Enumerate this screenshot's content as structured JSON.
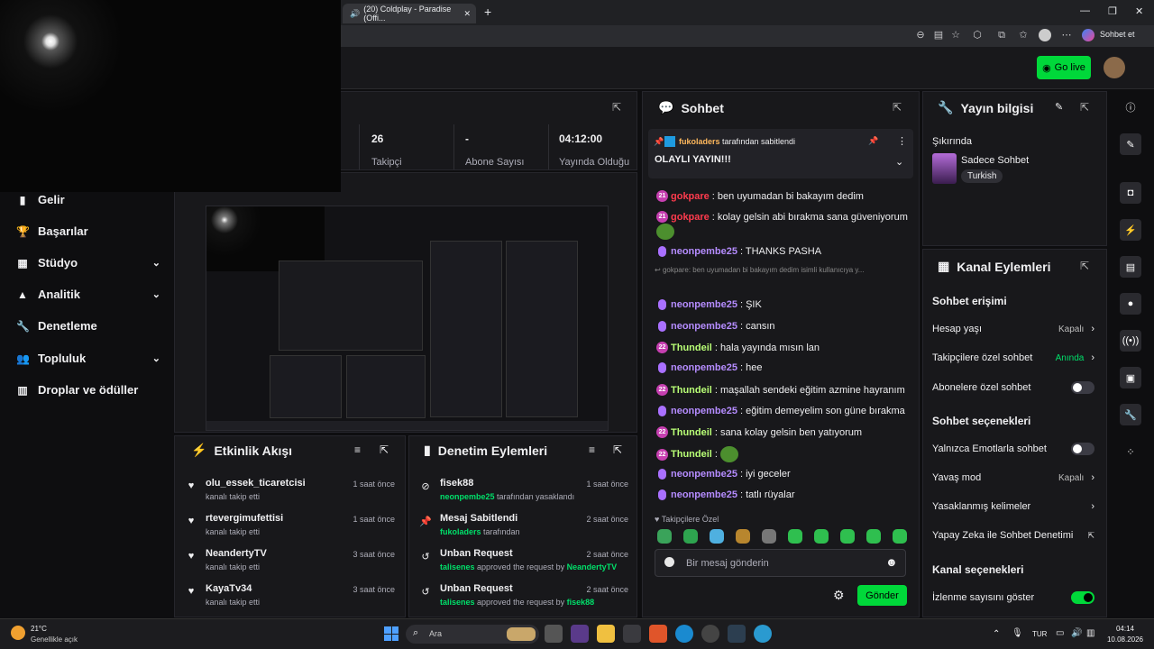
{
  "browser": {
    "tab_title": "(20) Coldplay - Paradise (Offi...",
    "sohbet_label": "Sohbet et"
  },
  "header": {
    "go_live": "Go live"
  },
  "nav": {
    "items": [
      {
        "label": "Gelir",
        "icon": "bars-icon",
        "expandable": false
      },
      {
        "label": "Başarılar",
        "icon": "trophy-icon",
        "expandable": false
      },
      {
        "label": "Stüdyo",
        "icon": "studio-icon",
        "expandable": true
      },
      {
        "label": "Analitik",
        "icon": "chart-icon",
        "expandable": true
      },
      {
        "label": "Denetleme",
        "icon": "wrench-icon",
        "expandable": false
      },
      {
        "label": "Topluluk",
        "icon": "community-icon",
        "expandable": true
      },
      {
        "label": "Droplar ve ödüller",
        "icon": "drops-icon",
        "expandable": false
      }
    ]
  },
  "stats": [
    {
      "value": "26",
      "label": "Takipçi"
    },
    {
      "value": "-",
      "label": "Abone Sayısı"
    },
    {
      "value": "04:12:00",
      "label": "Yayında Olduğu"
    }
  ],
  "activity": {
    "title": "Etkinlik Akışı",
    "items": [
      {
        "name": "olu_essek_ticaretcisi",
        "sub": "kanalı takip etti",
        "time": "1 saat önce"
      },
      {
        "name": "rtevergimufettisi",
        "sub": "kanalı takip etti",
        "time": "1 saat önce"
      },
      {
        "name": "NeandertyTV",
        "sub": "kanalı takip etti",
        "time": "3 saat önce"
      },
      {
        "name": "KayaTv34",
        "sub": "kanalı takip etti",
        "time": "3 saat önce"
      }
    ]
  },
  "moderation": {
    "title": "Denetim Eylemleri",
    "items": [
      {
        "title": "fisek88",
        "actor": "neonpembe25",
        "rest": "tarafından yasaklandı",
        "time": "1 saat önce",
        "icon": "ban-icon"
      },
      {
        "title": "Mesaj Sabitlendi",
        "actor": "fukoladers",
        "rest": "tarafından",
        "time": "2 saat önce",
        "icon": "pin-icon"
      },
      {
        "title": "Unban Request",
        "actor": "talisenes",
        "rest": "approved the request by",
        "target": "NeandertyTV",
        "time": "2 saat önce",
        "icon": "undo-icon"
      },
      {
        "title": "Unban Request",
        "actor": "talisenes",
        "rest": "approved the request by",
        "target": "fisek88",
        "time": "2 saat önce",
        "icon": "undo-icon"
      }
    ]
  },
  "chat": {
    "title": "Sohbet",
    "pinned_by": "fukoladers",
    "pinned_suffix": "tarafından sabitlendi",
    "pinned_text": "OLAYLI YAYIN!!!",
    "messages": [
      {
        "user": "gokpare",
        "text": ": ben uyumadan bi bakayım dedim",
        "badge": "21",
        "cls": "u1"
      },
      {
        "user": "gokpare",
        "text": ": kolay gelsin abi bırakma sana güveniyorum",
        "badge": "21",
        "cls": "u1"
      },
      {
        "user": "neonpembe25",
        "text": ": THANKS PASHA",
        "badge": "mic",
        "cls": "u2"
      },
      {
        "user": "neonpembe25",
        "text": ": ŞIK",
        "badge": "mic",
        "cls": "u2"
      },
      {
        "user": "neonpembe25",
        "text": ": cansın",
        "badge": "mic",
        "cls": "u2"
      },
      {
        "user": "Thundeil",
        "text": ": hala yayında mısın lan",
        "badge": "22",
        "cls": "u3"
      },
      {
        "user": "neonpembe25",
        "text": ": hee",
        "badge": "mic",
        "cls": "u2"
      },
      {
        "user": "Thundeil",
        "text": ": maşallah sendeki eğitim azmine hayranım",
        "badge": "22",
        "cls": "u3"
      },
      {
        "user": "neonpembe25",
        "text": ": eğitim demeyelim son güne bırakma",
        "badge": "mic",
        "cls": "u2"
      },
      {
        "user": "Thundeil",
        "text": ": sana kolay gelsin ben yatıyorum",
        "badge": "22",
        "cls": "u3"
      },
      {
        "user": "Thundeil",
        "text": ":",
        "badge": "22",
        "cls": "u3"
      },
      {
        "user": "neonpembe25",
        "text": ": iyi geceler",
        "badge": "mic",
        "cls": "u2"
      },
      {
        "user": "neonpembe25",
        "text": ": tatlı rüyalar",
        "badge": "mic",
        "cls": "u2"
      }
    ],
    "reply_note": "gokpare: ben uyumadan bi bakayım dedim isimli kullanıcıya y...",
    "followers_only": "Takipçilere Özel",
    "input_placeholder": "Bir mesaj gönderin",
    "send": "Gönder"
  },
  "stream_info": {
    "title": "Yayın bilgisi",
    "category_label": "Şıkırında",
    "category": "Sadece Sohbet",
    "language": "Turkish"
  },
  "channel_actions": {
    "title": "Kanal Eylemleri",
    "chat_access": "Sohbet erişimi",
    "account_age": "Hesap yaşı",
    "account_age_val": "Kapalı",
    "followers_chat": "Takipçilere özel sohbet",
    "followers_chat_val": "Anında",
    "subscribers_chat": "Abonelere özel sohbet",
    "chat_options": "Sohbet seçenekleri",
    "emote_only": "Yalnızca Emotlarla sohbet",
    "slow_mode": "Yavaş mod",
    "slow_mode_val": "Kapalı",
    "banned_words": "Yasaklanmış kelimeler",
    "ai_moderation": "Yapay Zeka ile Sohbet Denetimi",
    "channel_options": "Kanal seçenekleri",
    "show_views": "İzlenme sayısını göster"
  },
  "taskbar": {
    "weather_temp": "21°C",
    "weather_desc": "Genellikle açık",
    "search": "Ara",
    "lang": "TUR",
    "time": "04:14",
    "date": "10.08.2026"
  }
}
